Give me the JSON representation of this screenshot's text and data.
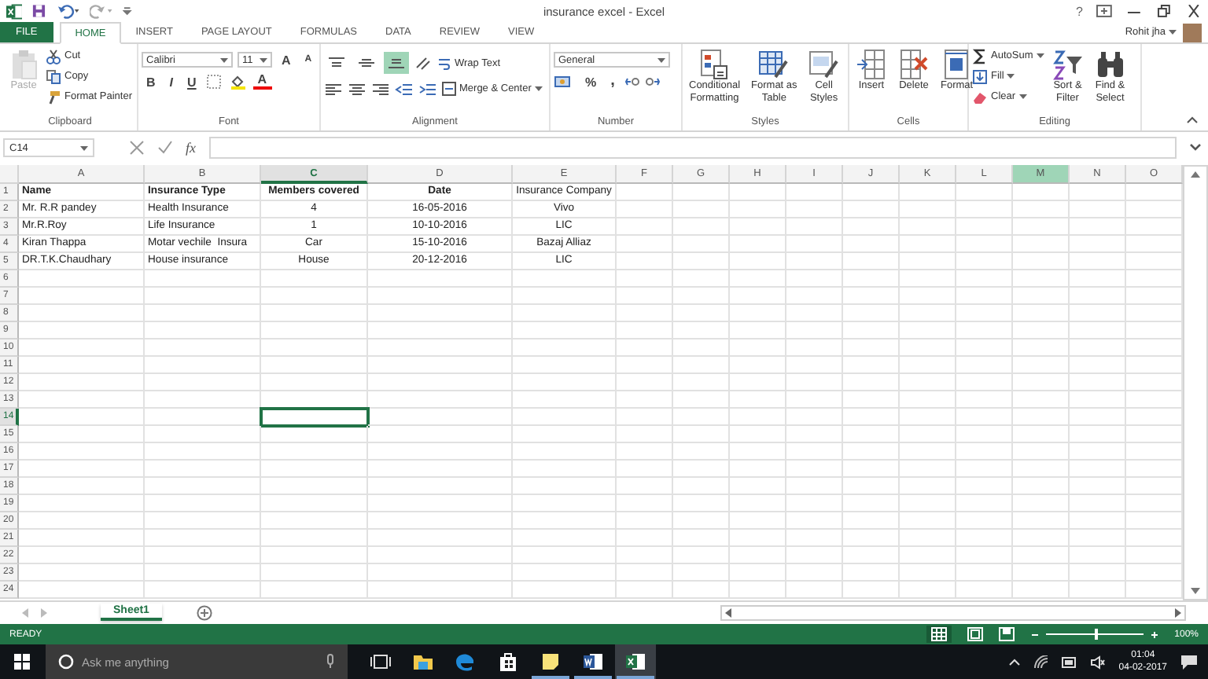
{
  "window": {
    "title": "insurance excel - Excel",
    "user": "Rohit jha",
    "help": "?"
  },
  "tabs": [
    {
      "label": "FILE",
      "kind": "file",
      "selected": false
    },
    {
      "label": "HOME",
      "kind": "tab",
      "selected": true
    },
    {
      "label": "INSERT",
      "kind": "tab",
      "selected": false
    },
    {
      "label": "PAGE LAYOUT",
      "kind": "tab",
      "selected": false
    },
    {
      "label": "FORMULAS",
      "kind": "tab",
      "selected": false
    },
    {
      "label": "DATA",
      "kind": "tab",
      "selected": false
    },
    {
      "label": "REVIEW",
      "kind": "tab",
      "selected": false
    },
    {
      "label": "VIEW",
      "kind": "tab",
      "selected": false
    }
  ],
  "ribbon": {
    "clipboard": {
      "label": "Clipboard",
      "paste": {
        "label": "Paste",
        "disabled": true
      },
      "tools": [
        {
          "kind": "cut",
          "label": "Cut"
        },
        {
          "kind": "copy",
          "label": "Copy"
        },
        {
          "kind": "painter",
          "label": "Format Painter"
        }
      ]
    },
    "font": {
      "label": "Font",
      "name": "Calibri",
      "size": "11",
      "grow": "A",
      "shrink": "A",
      "styles": [
        "B",
        "I",
        "U"
      ],
      "color_glyph": "A"
    },
    "alignment": {
      "label": "Alignment",
      "vertical": [
        {
          "kind": "top",
          "selected": false
        },
        {
          "kind": "middle",
          "selected": false
        },
        {
          "kind": "bottom",
          "selected": true
        }
      ],
      "wrap": "Wrap Text",
      "merge": "Merge & Center"
    },
    "number": {
      "label": "Number",
      "format": "General",
      "percent": "%",
      "comma": ","
    },
    "styles": {
      "label": "Styles",
      "buttons": [
        {
          "kind": "conditional",
          "lines": [
            "Conditional",
            "Formatting"
          ]
        },
        {
          "kind": "table",
          "lines": [
            "Format as",
            "Table"
          ]
        },
        {
          "kind": "cellstyles",
          "lines": [
            "Cell",
            "Styles"
          ]
        }
      ]
    },
    "cells": {
      "label": "Cells",
      "buttons": [
        {
          "kind": "insert",
          "label": "Insert"
        },
        {
          "kind": "delete",
          "label": "Delete"
        },
        {
          "kind": "format",
          "label": "Format"
        }
      ]
    },
    "editing": {
      "label": "Editing",
      "tools": [
        {
          "kind": "autosum",
          "label": "AutoSum"
        },
        {
          "kind": "fill",
          "label": "Fill"
        },
        {
          "kind": "clear",
          "label": "Clear"
        }
      ],
      "buttons": [
        {
          "kind": "sort",
          "lines": [
            "Sort &",
            "Filter"
          ]
        },
        {
          "kind": "find",
          "lines": [
            "Find &",
            "Select"
          ]
        }
      ]
    }
  },
  "formula_bar": {
    "name_box": "C14",
    "function_glyph": "fx"
  },
  "sheet": {
    "columns": [
      {
        "letter": "A",
        "selected": false,
        "hovered": false
      },
      {
        "letter": "B",
        "selected": false,
        "hovered": false
      },
      {
        "letter": "C",
        "selected": true,
        "hovered": false
      },
      {
        "letter": "D",
        "selected": false,
        "hovered": false
      },
      {
        "letter": "E",
        "selected": false,
        "hovered": false
      },
      {
        "letter": "F",
        "selected": false,
        "hovered": false
      },
      {
        "letter": "G",
        "selected": false,
        "hovered": false
      },
      {
        "letter": "H",
        "selected": false,
        "hovered": false
      },
      {
        "letter": "I",
        "selected": false,
        "hovered": false
      },
      {
        "letter": "J",
        "selected": false,
        "hovered": false
      },
      {
        "letter": "K",
        "selected": false,
        "hovered": false
      },
      {
        "letter": "L",
        "selected": false,
        "hovered": false
      },
      {
        "letter": "M",
        "selected": false,
        "hovered": true
      },
      {
        "letter": "N",
        "selected": false,
        "hovered": false
      },
      {
        "letter": "O",
        "selected": false,
        "hovered": false
      }
    ],
    "rows": [
      {
        "number": "1",
        "selected": false,
        "cells": [
          {
            "text": "Name",
            "bold": true
          },
          {
            "text": "Insurance Type",
            "bold": true
          },
          {
            "text": "Members covered",
            "bold": true
          },
          {
            "text": "Date",
            "bold": true
          },
          {
            "text": "Insurance Company",
            "bold": false
          }
        ]
      },
      {
        "number": "2",
        "selected": false,
        "cells": [
          {
            "text": "Mr. R.R pandey",
            "bold": false
          },
          {
            "text": "Health Insurance",
            "bold": false
          },
          {
            "text": "4",
            "bold": false
          },
          {
            "text": "16-05-2016",
            "bold": false
          },
          {
            "text": "Vivo",
            "bold": false
          }
        ]
      },
      {
        "number": "3",
        "selected": false,
        "cells": [
          {
            "text": "Mr.R.Roy",
            "bold": false
          },
          {
            "text": "Life Insurance",
            "bold": false
          },
          {
            "text": "1",
            "bold": false
          },
          {
            "text": "10-10-2016",
            "bold": false
          },
          {
            "text": "LIC",
            "bold": false
          }
        ]
      },
      {
        "number": "4",
        "selected": false,
        "cells": [
          {
            "text": "Kiran Thappa",
            "bold": false
          },
          {
            "text": "Motar vechile  Insura",
            "bold": false
          },
          {
            "text": "Car",
            "bold": false
          },
          {
            "text": "15-10-2016",
            "bold": false
          },
          {
            "text": "Bazaj Alliaz",
            "bold": false
          }
        ]
      },
      {
        "number": "5",
        "selected": false,
        "cells": [
          {
            "text": "DR.T.K.Chaudhary",
            "bold": false
          },
          {
            "text": "House insurance",
            "bold": false
          },
          {
            "text": "House",
            "bold": false
          },
          {
            "text": "20-12-2016",
            "bold": false
          },
          {
            "text": "LIC",
            "bold": false
          }
        ]
      },
      {
        "number": "6",
        "selected": false
      },
      {
        "number": "7",
        "selected": false
      },
      {
        "number": "8",
        "selected": false
      },
      {
        "number": "9",
        "selected": false
      },
      {
        "number": "10",
        "selected": false
      },
      {
        "number": "11",
        "selected": false
      },
      {
        "number": "12",
        "selected": false
      },
      {
        "number": "13",
        "selected": false
      },
      {
        "number": "14",
        "selected": true
      },
      {
        "number": "15",
        "selected": false
      },
      {
        "number": "16",
        "selected": false
      },
      {
        "number": "17",
        "selected": false
      },
      {
        "number": "18",
        "selected": false
      },
      {
        "number": "19",
        "selected": false
      },
      {
        "number": "20",
        "selected": false
      },
      {
        "number": "21",
        "selected": false
      },
      {
        "number": "22",
        "selected": false
      },
      {
        "number": "23",
        "selected": false
      },
      {
        "number": "24",
        "selected": false
      }
    ]
  },
  "sheet_tabs": [
    {
      "label": "Sheet1",
      "selected": true
    }
  ],
  "status_bar": {
    "mode": "READY",
    "zoom": "100%",
    "zoom_slider": {
      "level": 0.5
    }
  },
  "taskbar": {
    "search_placeholder": "Ask me anything",
    "apps": [
      {
        "kind": "taskview",
        "running": false,
        "active": false
      },
      {
        "kind": "explorer",
        "running": false,
        "active": false
      },
      {
        "kind": "edge",
        "running": false,
        "active": false
      },
      {
        "kind": "store",
        "running": false,
        "active": false
      },
      {
        "kind": "notes",
        "running": true,
        "active": false
      },
      {
        "kind": "word",
        "running": true,
        "active": false
      },
      {
        "kind": "excel",
        "running": true,
        "active": true
      }
    ],
    "time": "01:04",
    "date": "04-02-2017"
  }
}
